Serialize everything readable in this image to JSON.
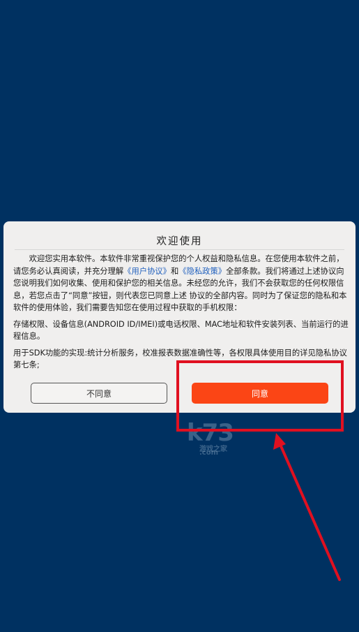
{
  "dialog": {
    "title": "欢迎使用",
    "paragraph1_part1": "欢迎您实用本软件。本软件非常重视保护您的个人权益和隐私信息。在您使用本软件之前，请您务必认真阅读，并充分理解",
    "link_user_agreement": "《用户协议》",
    "paragraph1_and": "和",
    "link_privacy_policy": "《隐私政策》",
    "paragraph1_part2": "全部条款。我们将通过上述协议向您说明我们如何收集、使用和保护您的相关信息。未经您的允许，我们不会获取您的任何权限信息，若您点击了“同意”按钮，则代表您已同意上述 协议的全部内容。同时为了保证您的隐私和本软件的使用体验，我们需要告知您在使用过程中获取的手机权限：",
    "paragraph2": "存储权限、设备信息(ANDROID ID/IMEI)或电话权限、MAC地址和软件安装列表、当前运行的进程信息。",
    "paragraph3": "用于SDK功能的实现:统计分析服务，校准报表数据准确性等，各权限具体使用目的详见隐私协议第七条;",
    "disagree_label": "不同意",
    "agree_label": "同意"
  },
  "watermark": {
    "main": "k73",
    "sub": "游戏之家",
    "domain": ".com"
  },
  "colors": {
    "background": "#003161",
    "agree_button": "#fb4515",
    "link": "#1f5fbd",
    "annotation": "#e01020"
  }
}
